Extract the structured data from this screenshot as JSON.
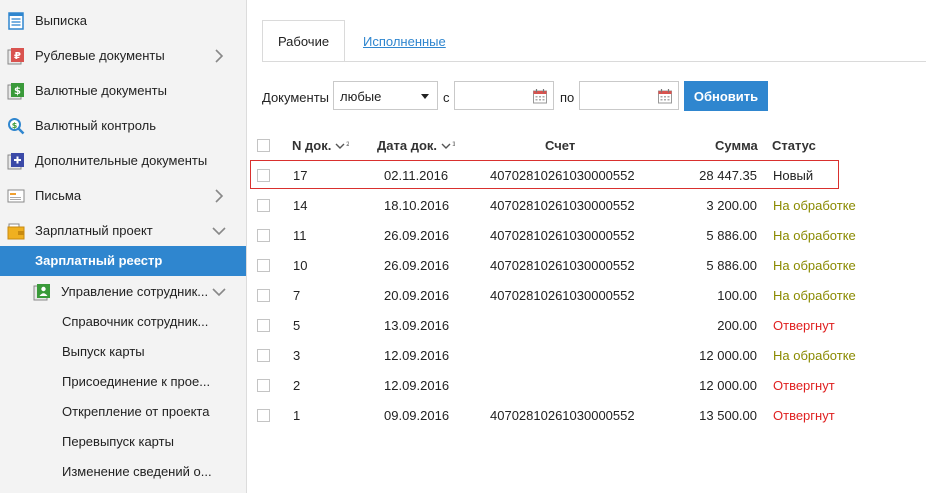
{
  "sidebar": {
    "items": [
      {
        "label": "Выписка",
        "icon": "statement-icon",
        "chevron": false
      },
      {
        "label": "Рублевые документы",
        "icon": "ruble-document-icon",
        "chevron": "right"
      },
      {
        "label": "Валютные документы",
        "icon": "currency-document-icon",
        "chevron": false
      },
      {
        "label": "Валютный контроль",
        "icon": "search-dollar-icon",
        "chevron": false
      },
      {
        "label": "Дополнительные документы",
        "icon": "plus-document-icon",
        "chevron": false
      },
      {
        "label": "Письма",
        "icon": "letter-icon",
        "chevron": "right"
      },
      {
        "label": "Зарплатный проект",
        "icon": "wallet-icon",
        "chevron": "down"
      },
      {
        "label": "Зарплатный реестр",
        "icon": "",
        "chevron": false,
        "active": true
      },
      {
        "label": "Управление сотрудник...",
        "icon": "employee-folder-icon",
        "chevron": "down"
      },
      {
        "label": "Справочник сотрудник...",
        "icon": "",
        "chevron": false
      },
      {
        "label": "Выпуск карты",
        "icon": "",
        "chevron": false
      },
      {
        "label": "Присоединение к прое...",
        "icon": "",
        "chevron": false
      },
      {
        "label": "Открепление от проекта",
        "icon": "",
        "chevron": false
      },
      {
        "label": "Перевыпуск карты",
        "icon": "",
        "chevron": false
      },
      {
        "label": "Изменение сведений о...",
        "icon": "",
        "chevron": false
      }
    ]
  },
  "tabs": {
    "active": "Рабочие",
    "other": "Исполненные"
  },
  "filter": {
    "documents_label": "Документы",
    "documents_value": "любые",
    "from_label": "с",
    "from_value": "",
    "to_label": "по",
    "to_value": "",
    "refresh_button": "Обновить"
  },
  "table": {
    "headers": {
      "num": "N док.",
      "date": "Дата док.",
      "account": "Счет",
      "sum": "Сумма",
      "status": "Статус"
    },
    "sort_badges": {
      "num": "2",
      "date": "1"
    },
    "rows": [
      {
        "num": "17",
        "date": "02.11.2016",
        "account": "40702810261030000552",
        "sum": "28 447.35",
        "status": "Новый",
        "status_type": "new",
        "selected": true
      },
      {
        "num": "14",
        "date": "18.10.2016",
        "account": "40702810261030000552",
        "sum": "3 200.00",
        "status": "На обработке",
        "status_type": "processing"
      },
      {
        "num": "11",
        "date": "26.09.2016",
        "account": "40702810261030000552",
        "sum": "5 886.00",
        "status": "На обработке",
        "status_type": "processing"
      },
      {
        "num": "10",
        "date": "26.09.2016",
        "account": "40702810261030000552",
        "sum": "5 886.00",
        "status": "На обработке",
        "status_type": "processing"
      },
      {
        "num": "7",
        "date": "20.09.2016",
        "account": "40702810261030000552",
        "sum": "100.00",
        "status": "На обработке",
        "status_type": "processing"
      },
      {
        "num": "5",
        "date": "13.09.2016",
        "account": "",
        "sum": "200.00",
        "status": "Отвергнут",
        "status_type": "rejected"
      },
      {
        "num": "3",
        "date": "12.09.2016",
        "account": "",
        "sum": "12 000.00",
        "status": "На обработке",
        "status_type": "processing"
      },
      {
        "num": "2",
        "date": "12.09.2016",
        "account": "",
        "sum": "12 000.00",
        "status": "Отвергнут",
        "status_type": "rejected"
      },
      {
        "num": "1",
        "date": "09.09.2016",
        "account": "40702810261030000552",
        "sum": "13 500.00",
        "status": "Отвергнут",
        "status_type": "rejected"
      }
    ]
  },
  "colors": {
    "accent": "#2f86cf",
    "status_new": "#222222",
    "status_processing": "#8a8a00",
    "status_rejected": "#e02020",
    "selection_border": "#d9302e"
  }
}
